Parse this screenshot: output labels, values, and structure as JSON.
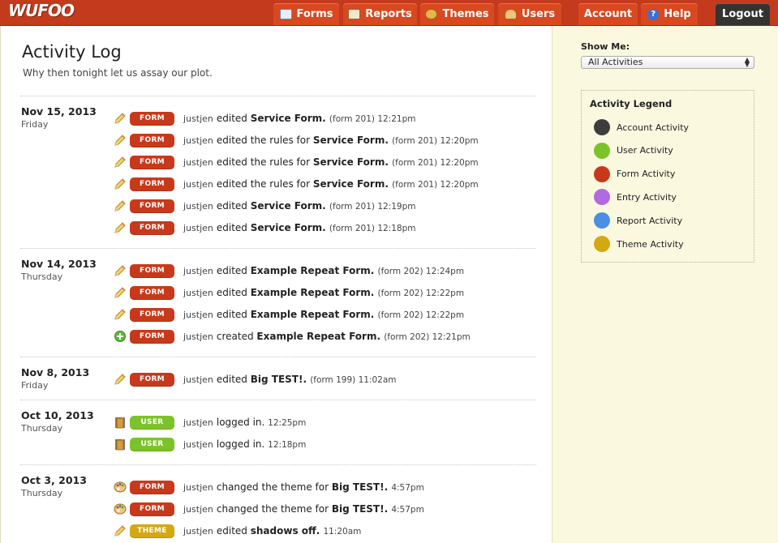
{
  "header": {
    "logo": "WUFOO",
    "nav": [
      {
        "label": "Forms"
      },
      {
        "label": "Reports"
      },
      {
        "label": "Themes"
      },
      {
        "label": "Users"
      },
      {
        "label": "Account"
      },
      {
        "label": "Help"
      },
      {
        "label": "Logout"
      }
    ]
  },
  "page": {
    "title": "Activity Log",
    "subtitle": "Why then tonight let us assay our plot."
  },
  "colors": {
    "form": "#c8391b",
    "user": "#7cc32b",
    "theme": "#d4a812",
    "account": "#3d3d3d",
    "entry": "#b16ae0",
    "report": "#4b8ee2"
  },
  "days": [
    {
      "date": "Nov 15, 2013",
      "weekday": "Friday",
      "entries": [
        {
          "icon": "pencil-icon",
          "badge": "FORM",
          "user": "justjen",
          "action": "edited",
          "item": "Service Form.",
          "meta": "(form 201) 12:21pm"
        },
        {
          "icon": "pencil-icon",
          "badge": "FORM",
          "user": "justjen",
          "action": "edited the rules for",
          "item": "Service Form.",
          "meta": "(form 201) 12:20pm"
        },
        {
          "icon": "pencil-icon",
          "badge": "FORM",
          "user": "justjen",
          "action": "edited the rules for",
          "item": "Service Form.",
          "meta": "(form 201) 12:20pm"
        },
        {
          "icon": "pencil-icon",
          "badge": "FORM",
          "user": "justjen",
          "action": "edited the rules for",
          "item": "Service Form.",
          "meta": "(form 201) 12:20pm"
        },
        {
          "icon": "pencil-icon",
          "badge": "FORM",
          "user": "justjen",
          "action": "edited",
          "item": "Service Form.",
          "meta": "(form 201) 12:19pm"
        },
        {
          "icon": "pencil-icon",
          "badge": "FORM",
          "user": "justjen",
          "action": "edited",
          "item": "Service Form.",
          "meta": "(form 201) 12:18pm"
        }
      ]
    },
    {
      "date": "Nov 14, 2013",
      "weekday": "Thursday",
      "entries": [
        {
          "icon": "pencil-icon",
          "badge": "FORM",
          "user": "justjen",
          "action": "edited",
          "item": "Example Repeat Form.",
          "meta": "(form 202) 12:24pm"
        },
        {
          "icon": "pencil-icon",
          "badge": "FORM",
          "user": "justjen",
          "action": "edited",
          "item": "Example Repeat Form.",
          "meta": "(form 202) 12:22pm"
        },
        {
          "icon": "pencil-icon",
          "badge": "FORM",
          "user": "justjen",
          "action": "edited",
          "item": "Example Repeat Form.",
          "meta": "(form 202) 12:22pm"
        },
        {
          "icon": "plus-icon",
          "badge": "FORM",
          "user": "justjen",
          "action": "created",
          "item": "Example Repeat Form.",
          "meta": "(form 202) 12:21pm"
        }
      ]
    },
    {
      "date": "Nov 8, 2013",
      "weekday": "Friday",
      "entries": [
        {
          "icon": "pencil-icon",
          "badge": "FORM",
          "user": "justjen",
          "action": "edited",
          "item": "Big TEST!.",
          "meta": "(form 199) 11:02am"
        }
      ]
    },
    {
      "date": "Oct 10, 2013",
      "weekday": "Thursday",
      "entries": [
        {
          "icon": "door-icon",
          "badge": "USER",
          "user": "justjen",
          "action": "logged in.",
          "item": "",
          "meta": "12:25pm"
        },
        {
          "icon": "door-icon",
          "badge": "USER",
          "user": "justjen",
          "action": "logged in.",
          "item": "",
          "meta": "12:18pm"
        }
      ]
    },
    {
      "date": "Oct 3, 2013",
      "weekday": "Thursday",
      "entries": [
        {
          "icon": "palette-icon",
          "badge": "FORM",
          "user": "justjen",
          "action": "changed the theme for",
          "item": "Big TEST!.",
          "meta": "4:57pm"
        },
        {
          "icon": "palette-icon",
          "badge": "FORM",
          "user": "justjen",
          "action": "changed the theme for",
          "item": "Big TEST!.",
          "meta": "4:57pm"
        },
        {
          "icon": "pencil-icon",
          "badge": "THEME",
          "user": "justjen",
          "action": "edited",
          "item": "shadows off.",
          "meta": "11:20am"
        }
      ]
    }
  ],
  "sidebar": {
    "show_label": "Show Me:",
    "select_value": "All Activities",
    "legend_title": "Activity Legend",
    "legend": [
      {
        "label": "Account Activity",
        "color": "#3d3d3d"
      },
      {
        "label": "User Activity",
        "color": "#7cc32b"
      },
      {
        "label": "Form Activity",
        "color": "#c8391b"
      },
      {
        "label": "Entry Activity",
        "color": "#b16ae0"
      },
      {
        "label": "Report Activity",
        "color": "#4b8ee2"
      },
      {
        "label": "Theme Activity",
        "color": "#d4a812"
      }
    ]
  }
}
